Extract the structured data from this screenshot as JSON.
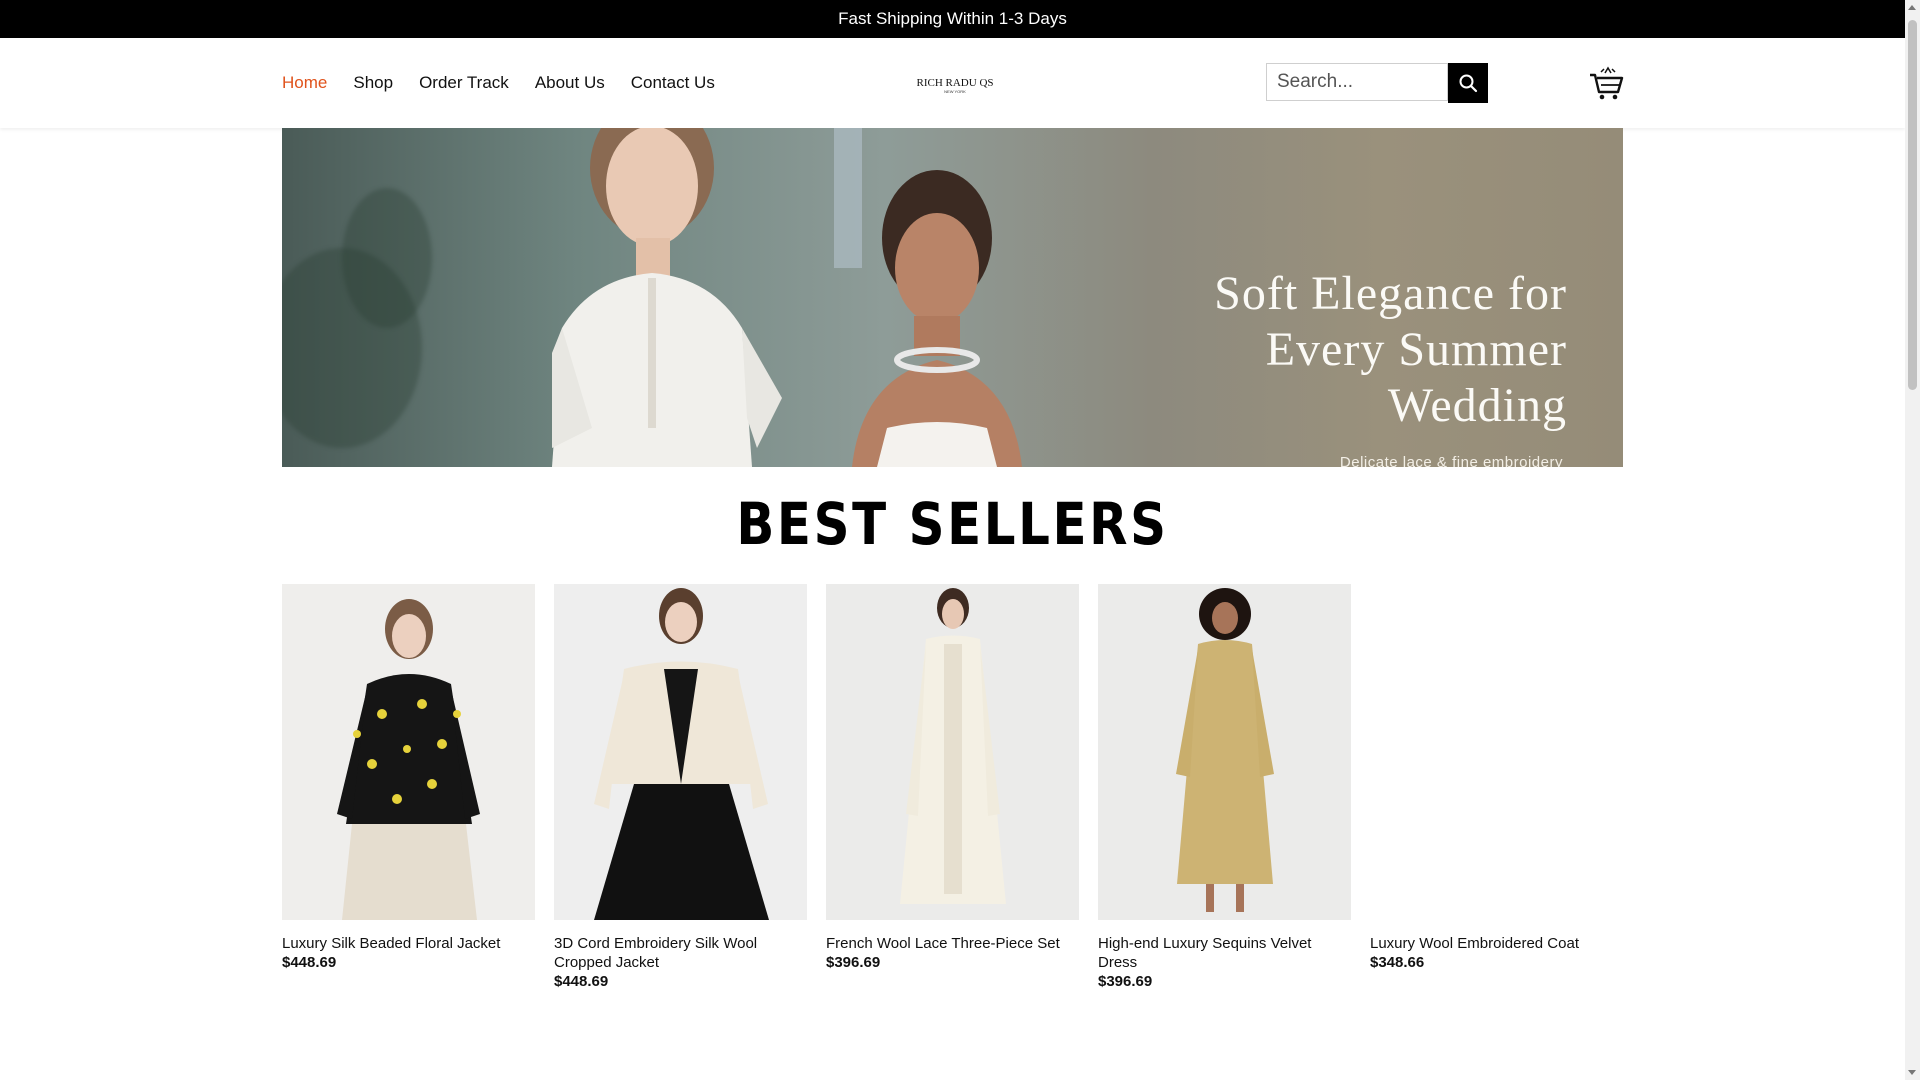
{
  "announcement": "Fast Shipping Within 1-3 Days",
  "nav": {
    "items": [
      {
        "label": "Home",
        "active": true
      },
      {
        "label": "Shop",
        "active": false
      },
      {
        "label": "Order Track",
        "active": false
      },
      {
        "label": "About Us",
        "active": false
      },
      {
        "label": "Contact Us",
        "active": false
      }
    ]
  },
  "logo": {
    "text": "RICH RADU QS",
    "subtext": "NEW YORK"
  },
  "search": {
    "placeholder": "Search..."
  },
  "hero": {
    "headline_lines": [
      "Soft Elegance for",
      "Every Summer",
      "Wedding"
    ],
    "subline": "Delicate lace & fine embroidery"
  },
  "best_sellers": {
    "title": "BEST SELLERS",
    "products": [
      {
        "name": "Luxury Silk Beaded Floral Jacket",
        "price": "$448.69"
      },
      {
        "name": "3D Cord Embroidery Silk Wool Cropped Jacket",
        "price": "$448.69"
      },
      {
        "name": "French Wool Lace Three-Piece Set",
        "price": "$396.69"
      },
      {
        "name": "High-end Luxury Sequins Velvet Dress",
        "price": "$396.69"
      },
      {
        "name": "Luxury Wool Embroidered Coat",
        "price": "$348.66"
      }
    ]
  },
  "colors": {
    "accent": "#e0531c",
    "topbar": "#000000"
  }
}
